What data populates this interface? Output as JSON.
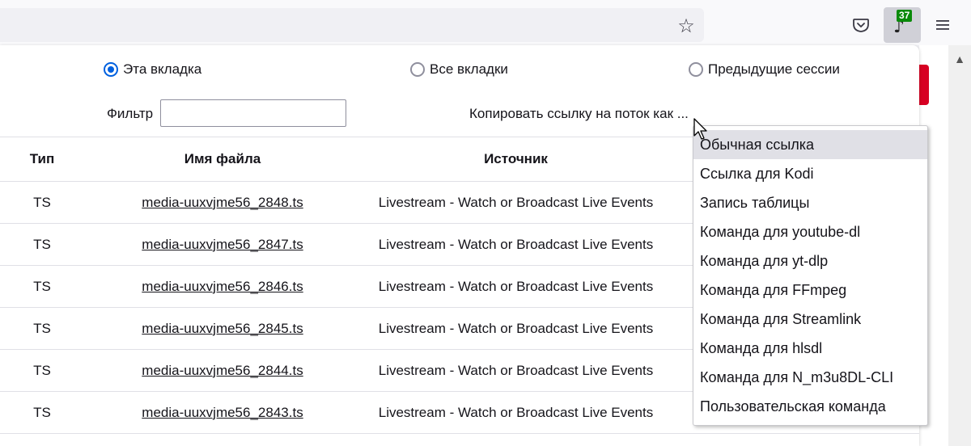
{
  "browser": {
    "extension_badge": "37",
    "icons": [
      "star-icon",
      "pocket-icon",
      "music-note-icon",
      "hamburger-menu-icon"
    ]
  },
  "panel": {
    "scope_options": [
      {
        "label": "Эта вкладка",
        "checked": true
      },
      {
        "label": "Все вкладки",
        "checked": false
      },
      {
        "label": "Предыдущие сессии",
        "checked": false
      }
    ],
    "filter_label": "Фильтр",
    "filter_value": "",
    "copy_label": "Копировать ссылку на поток как ..."
  },
  "table": {
    "headers": [
      "Тип",
      "Имя файла",
      "Источник"
    ],
    "rows": [
      {
        "type": "TS",
        "name": "media-uuxvjme56_2848.ts",
        "source": "Livestream - Watch or Broadcast Live Events"
      },
      {
        "type": "TS",
        "name": "media-uuxvjme56_2847.ts",
        "source": "Livestream - Watch or Broadcast Live Events"
      },
      {
        "type": "TS",
        "name": "media-uuxvjme56_2846.ts",
        "source": "Livestream - Watch or Broadcast Live Events"
      },
      {
        "type": "TS",
        "name": "media-uuxvjme56_2845.ts",
        "source": "Livestream - Watch or Broadcast Live Events"
      },
      {
        "type": "TS",
        "name": "media-uuxvjme56_2844.ts",
        "source": "Livestream - Watch or Broadcast Live Events"
      },
      {
        "type": "TS",
        "name": "media-uuxvjme56_2843.ts",
        "source": "Livestream - Watch or Broadcast Live Events"
      }
    ]
  },
  "dropdown": {
    "items": [
      "Обычная ссылка",
      "Ссылка для Kodi",
      "Запись таблицы",
      "Команда для youtube-dl",
      "Команда для yt-dlp",
      "Команда для FFmpeg",
      "Команда для Streamlink",
      "Команда для hlsdl",
      "Команда для N_m3u8DL-CLI",
      "Пользовательская команда"
    ],
    "selected_index": 0
  },
  "colors": {
    "accent": "#0060df",
    "badge": "#0a8a0a",
    "page_button": "#d70022"
  }
}
